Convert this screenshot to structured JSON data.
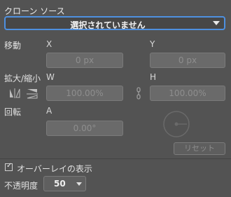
{
  "title": "クローン ソース",
  "source_select": {
    "value": "選択されていません"
  },
  "move": {
    "label": "移動",
    "x_label": "X",
    "y_label": "Y",
    "x_value": "0 px",
    "y_value": "0 px"
  },
  "scale": {
    "label": "拡大/縮小",
    "w_label": "W",
    "h_label": "H",
    "w_value": "100.00%",
    "h_value": "100.00%"
  },
  "rotate": {
    "label": "回転",
    "a_label": "A",
    "a_value": "0.00°"
  },
  "reset_label": "リセット",
  "overlay": {
    "label": "オーバーレイの表示",
    "checked": true
  },
  "opacity": {
    "label": "不透明度",
    "value": "50"
  },
  "icons": [
    "flip-horizontal-icon",
    "flip-vertical-icon",
    "link-icon",
    "rotation-dial-icon",
    "dropdown-arrow-icon"
  ]
}
